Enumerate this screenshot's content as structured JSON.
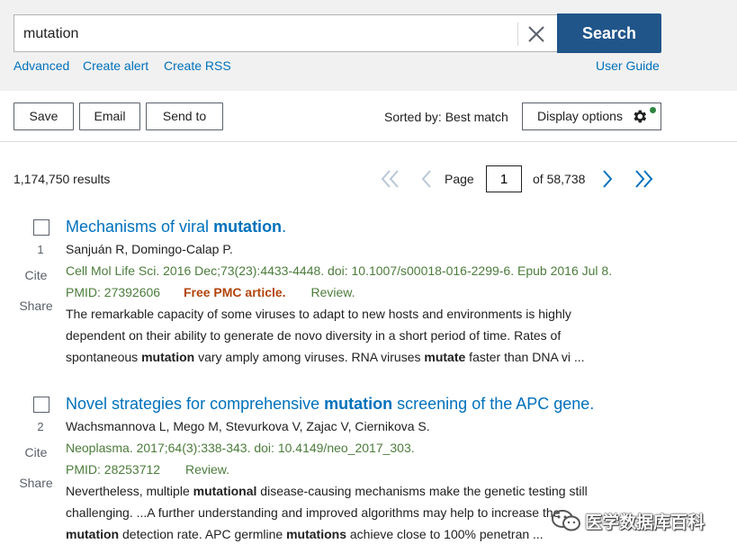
{
  "search": {
    "query": "mutation",
    "button_label": "Search",
    "links": [
      "Advanced",
      "Create alert",
      "Create RSS"
    ],
    "user_guide": "User Guide"
  },
  "toolbar": {
    "save_label": "Save",
    "email_label": "Email",
    "send_to_label": "Send to",
    "sorted_by": "Sorted by: Best match",
    "display_options": "Display options",
    "display_indicator_color": "#2e8540"
  },
  "results": {
    "count_text": "1,174,750 results",
    "page_label": "Page",
    "current_page": "1",
    "total_pages_text": "of 58,738"
  },
  "articles": [
    {
      "number": "1",
      "title_pre": "Mechanisms of viral ",
      "title_bold": "mutation",
      "title_post": ".",
      "authors": "Sanjuán R, Domingo-Calap P.",
      "citation": "Cell Mol Life Sci. 2016 Dec;73(23):4433-4448. doi: 10.1007/s00018-016-2299-6. Epub 2016 Jul 8.",
      "pmid": "PMID: 27392606",
      "free_pmc": "Free PMC article.",
      "review": "Review.",
      "cite": "Cite",
      "share": "Share",
      "snippet": [
        {
          "t": "The remarkable capacity of some viruses to adapt to new hosts and environments is highly dependent on their ability to generate de novo diversity in a short period of time. Rates of spontaneous ",
          "b": false
        },
        {
          "t": "mutation",
          "b": true
        },
        {
          "t": " vary amply among viruses. RNA viruses ",
          "b": false
        },
        {
          "t": "mutate",
          "b": true
        },
        {
          "t": " faster than DNA vi ...",
          "b": false
        }
      ]
    },
    {
      "number": "2",
      "title_pre": "Novel strategies for comprehensive ",
      "title_bold": "mutation",
      "title_post": " screening of the APC gene.",
      "authors": "Wachsmannova L, Mego M, Stevurkova V, Zajac V, Ciernikova S.",
      "citation": "Neoplasma. 2017;64(3):338-343. doi: 10.4149/neo_2017_303.",
      "pmid": "PMID: 28253712",
      "free_pmc": "",
      "review": "Review.",
      "cite": "Cite",
      "share": "Share",
      "snippet": [
        {
          "t": "Nevertheless, multiple ",
          "b": false
        },
        {
          "t": "mutational",
          "b": true
        },
        {
          "t": " disease-causing mechanisms make the genetic testing still challenging. ...A further understanding and improved algorithms may help to increase the ",
          "b": false
        },
        {
          "t": "mutation",
          "b": true
        },
        {
          "t": " detection rate. APC germline ",
          "b": false
        },
        {
          "t": "mutations",
          "b": true
        },
        {
          "t": " achieve close to 100% penetran ...",
          "b": false
        }
      ]
    }
  ],
  "watermark": {
    "text": "医学数据库百科",
    "icon": "wechat-logo-icon"
  },
  "colors": {
    "search_button": "#20558a",
    "link": "#0071bc",
    "citation": "#4b7c3b",
    "free_pmc": "#b3440b"
  }
}
